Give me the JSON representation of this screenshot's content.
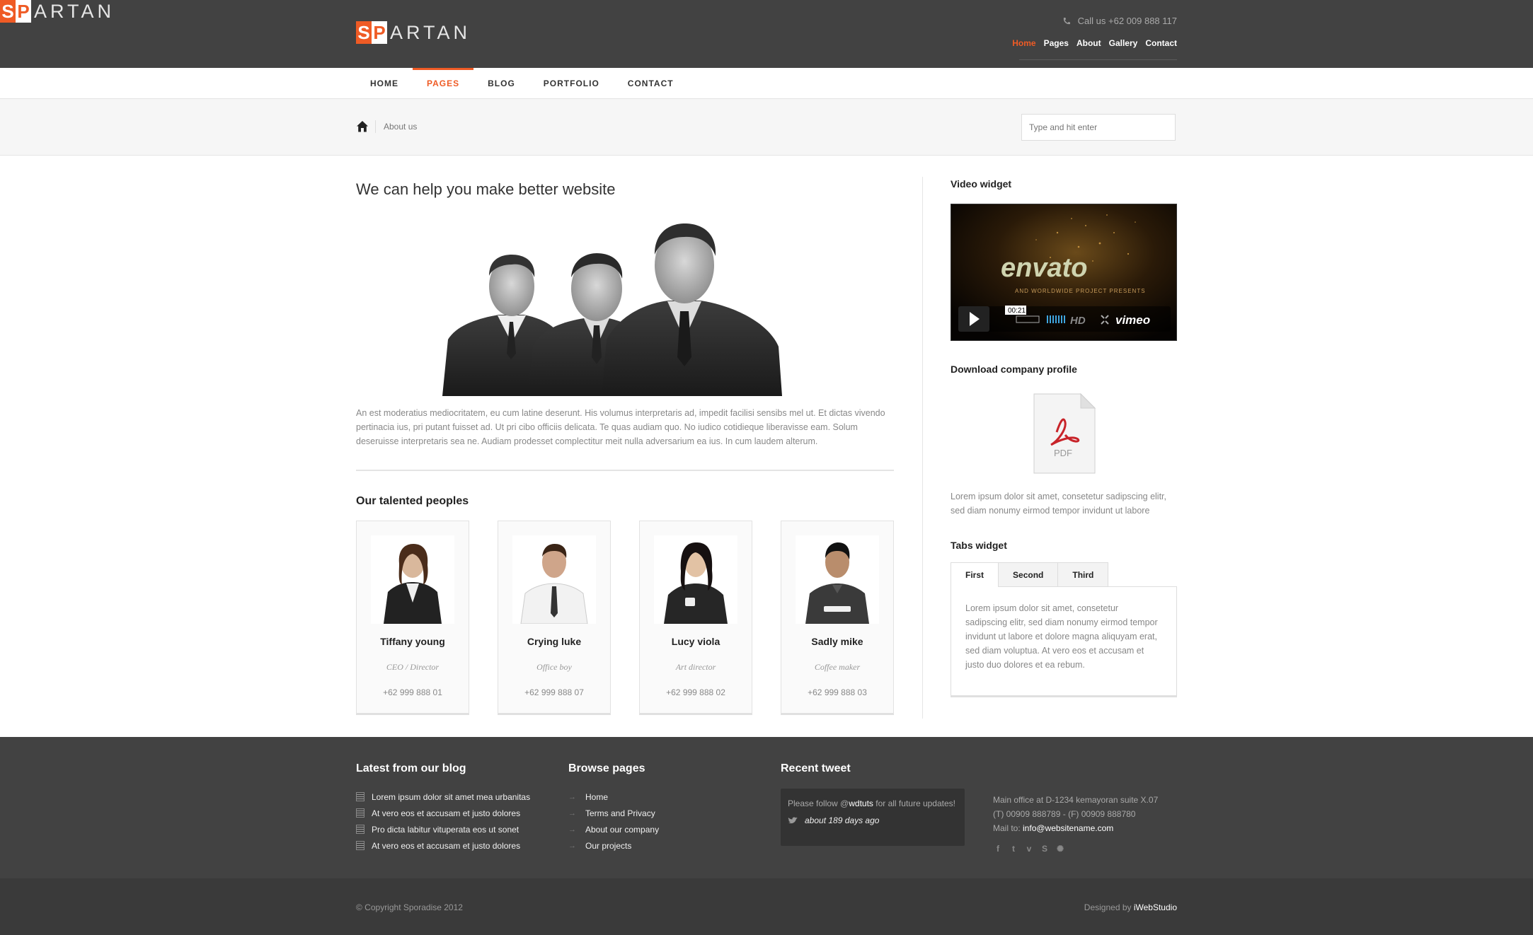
{
  "header": {
    "logo": {
      "s": "S",
      "p": "P",
      "rest": "ARTAN"
    },
    "call": "Call us +62 009 888 117",
    "top_links": [
      "Home",
      "Pages",
      "About",
      "Gallery",
      "Contact"
    ],
    "top_active": "Home"
  },
  "nav": {
    "items": [
      "HOME",
      "PAGES",
      "BLOG",
      "PORTFOLIO",
      "CONTACT"
    ],
    "active": "PAGES"
  },
  "breadcrumb": {
    "current": "About us"
  },
  "search": {
    "placeholder": "Type and hit enter"
  },
  "main": {
    "title": "We can help you make better website",
    "intro": "An est moderatius mediocritatem, eu cum latine deserunt. His volumus interpretaris ad, impedit facilisi sensibs mel ut. Et dictas vivendo pertinacia ius, pri putant fuisset ad. Ut pri cibo officiis delicata. Te quas audiam quo. No iudico cotidieque liberavisse eam. Solum deseruisse interpretaris sea ne. Audiam prodesset complectitur meit nulla adversarium ea ius. In cum laudem alterum.",
    "people_title": "Our talented peoples",
    "people": [
      {
        "name": "Tiffany young",
        "role": "CEO / Director",
        "phone": "+62 999 888 01"
      },
      {
        "name": "Crying luke",
        "role": "Office boy",
        "phone": "+62 999 888 07"
      },
      {
        "name": "Lucy viola",
        "role": "Art director",
        "phone": "+62 999 888 02"
      },
      {
        "name": "Sadly mike",
        "role": "Coffee maker",
        "phone": "+62 999 888 03"
      }
    ]
  },
  "sidebar": {
    "video_title": "Video widget",
    "video": {
      "brand": "envato",
      "subtitle": "AND WORLDWIDE PROJECT PRESENTS",
      "time": "00:21",
      "hd": "HD",
      "player": "vimeo"
    },
    "download_title": "Download company profile",
    "pdf_label": "PDF",
    "download_text": "Lorem ipsum dolor sit amet, consetetur sadipscing elitr, sed diam nonumy eirmod tempor invidunt ut labore",
    "tabs_title": "Tabs widget",
    "tabs": [
      "First",
      "Second",
      "Third"
    ],
    "tabs_active": "First",
    "tab_content": "Lorem ipsum dolor sit amet, consetetur sadipscing elitr, sed diam nonumy eirmod tempor invidunt ut labore et dolore magna aliquyam erat, sed diam voluptua. At vero eos et accusam et justo duo dolores et ea rebum."
  },
  "footer": {
    "blog_title": "Latest from our blog",
    "blog_items": [
      "Lorem ipsum dolor sit amet mea urbanitas",
      "At vero eos et accusam et justo dolores",
      "Pro dicta labitur vituperata eos ut sonet",
      "At vero eos et accusam et justo dolores"
    ],
    "browse_title": "Browse pages",
    "browse_items": [
      "Home",
      "Terms and Privacy",
      "About our company",
      "Our projects"
    ],
    "tweet_title": "Recent tweet",
    "tweet": {
      "pre": "Please follow @",
      "handle": "wdtuts",
      "post": " for all future updates!",
      "time": "about 189 days ago"
    },
    "info": {
      "office": "Main office at D-1234 kemayoran suite X.07",
      "phones": "(T) 00909 888789 - (F) 00909 888780",
      "mail_label": "Mail to: ",
      "mail": "info@websitename.com"
    },
    "social": [
      "facebook-icon",
      "twitter-icon",
      "vimeo-icon",
      "skype-icon",
      "dribbble-icon"
    ],
    "copyright": "© Copyright Sporadise 2012",
    "designed_label": "Designed by ",
    "designer": "iWebStudio"
  },
  "colors": {
    "accent": "#ef5b25",
    "header_bg": "#424242",
    "footer_bg": "#424242",
    "bottom_bg": "#3a3a3a"
  }
}
